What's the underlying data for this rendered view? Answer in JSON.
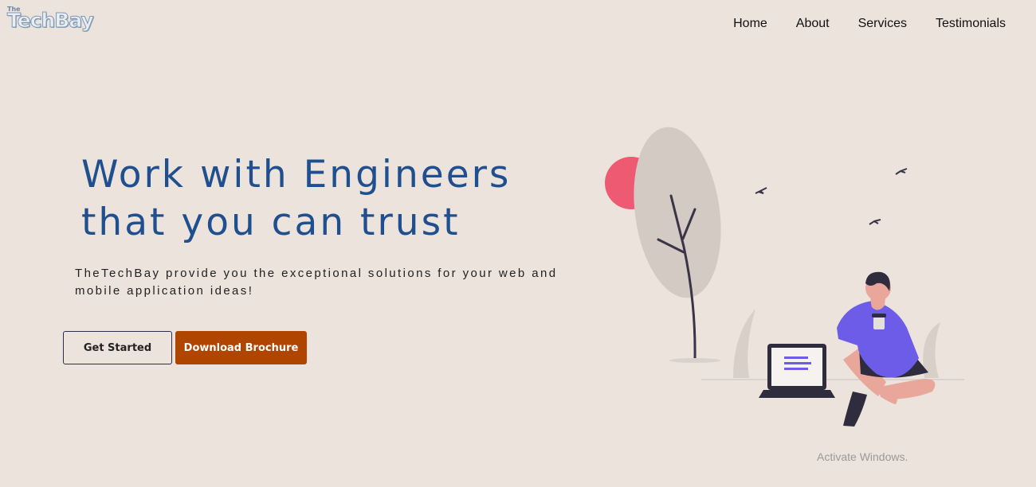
{
  "brand": {
    "logo_small": "The",
    "logo_text": "TechBay"
  },
  "nav": {
    "items": [
      "Home",
      "About",
      "Services",
      "Testimonials"
    ]
  },
  "hero": {
    "title_line1": "Work with Engineers",
    "title_line2": "that you can trust",
    "subtitle": "TheTechBay provide you the exceptional solutions for your web and mobile application ideas!",
    "get_started_label": "Get Started",
    "download_label": "Download Brochure"
  },
  "watermark": {
    "text": "Activate Windows."
  },
  "colors": {
    "background": "#ece3dc",
    "title": "#1f4f8f",
    "accent": "#b04500",
    "sun": "#ee5a72",
    "shirt": "#6c5ce7"
  }
}
